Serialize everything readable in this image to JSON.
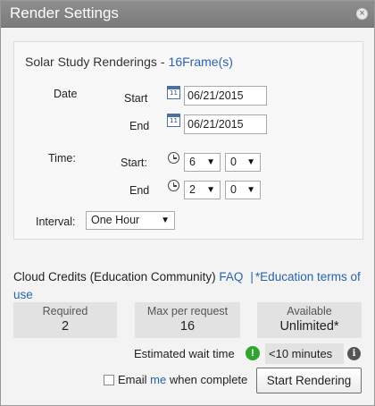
{
  "window": {
    "title": "Render Settings",
    "close_glyph": "×"
  },
  "panel": {
    "heading": "Solar Study Renderings",
    "separator": "-",
    "frames_label": "16Frame(s)",
    "date_label": "Date",
    "start_label": "Start",
    "end_label": "End",
    "start_date": "06/21/2015",
    "end_date": "06/21/2015",
    "time_label": "Time:",
    "time_start_label": "Start:",
    "time_end_label": "End",
    "time_start_hour": "6",
    "time_start_minute": "0",
    "time_end_hour": "2",
    "time_end_minute": "0",
    "interval_label": "Interval:",
    "interval_value": "One Hour",
    "calendar_icon_glyph": "11"
  },
  "credits": {
    "title": "Cloud Credits",
    "community": "(Education Community)",
    "faq_link": "FAQ",
    "pipe": "|",
    "terms_link": "*Education terms of use",
    "required_label": "Required",
    "required_value": "2",
    "max_label": "Max per request",
    "max_value": "16",
    "available_label": "Available",
    "available_value": "Unlimited*"
  },
  "wait": {
    "label": "Estimated wait time",
    "status_glyph": "!",
    "value": "<10 minutes",
    "info_glyph": "i"
  },
  "footer": {
    "email_prefix": "Email",
    "email_me": "me",
    "email_suffix": "when complete",
    "start_button": "Start Rendering"
  },
  "icons": [
    "close-icon",
    "calendar-icon",
    "clock-icon",
    "chevron-down-icon",
    "status-ok-icon",
    "info-icon"
  ],
  "colors": {
    "titlebar": "#858585",
    "link": "#2a64a8",
    "status_ok": "#2fa52f",
    "stat_bg": "#e2e2e2"
  },
  "arrow_glyph": "▼"
}
